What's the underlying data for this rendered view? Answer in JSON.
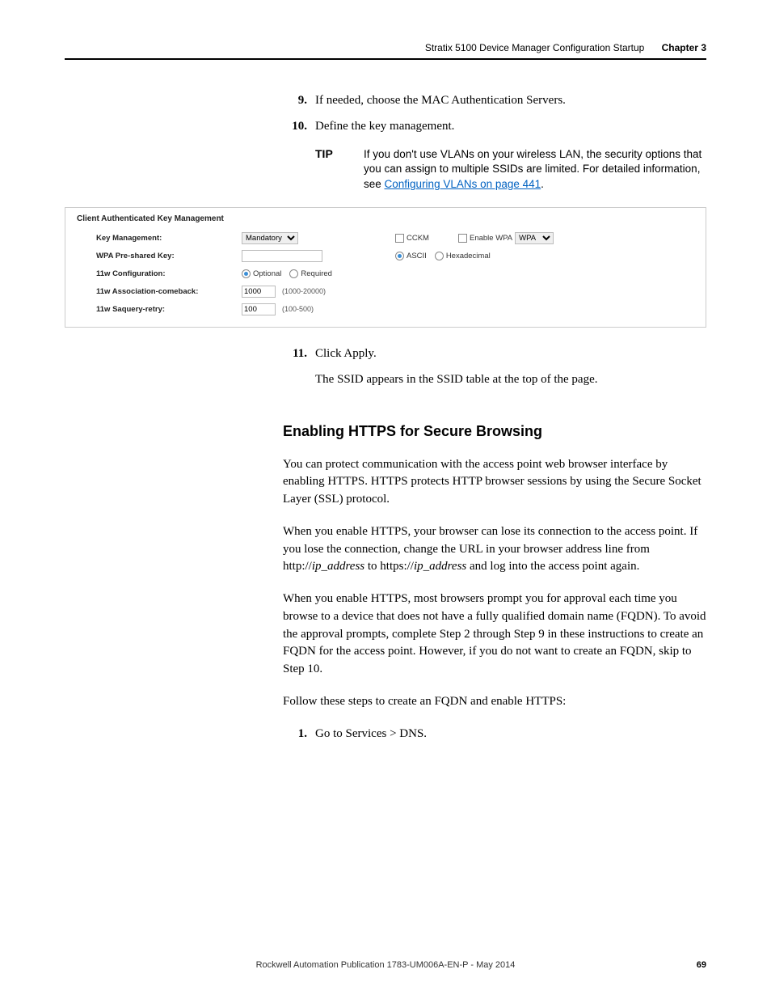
{
  "header": {
    "doc_title": "Stratix 5100 Device Manager Configuration Startup",
    "chapter": "Chapter 3"
  },
  "steps": {
    "s9": {
      "num": "9.",
      "text": "If needed, choose the MAC Authentication Servers."
    },
    "s10": {
      "num": "10.",
      "text": "Define the key management."
    },
    "s11": {
      "num": "11.",
      "text": "Click Apply."
    },
    "s11_after": "The SSID appears in the SSID table at the top of the page.",
    "s1b": {
      "num": "1.",
      "text": "Go to Services > DNS."
    }
  },
  "tip": {
    "label": "TIP",
    "text_pre": "If you don't use VLANs on your wireless LAN, the security options that you can assign to multiple SSIDs are limited. For detailed information, see ",
    "link": "Configuring VLANs on page 441",
    "text_post": "."
  },
  "panel": {
    "heading": "Client Authenticated Key Management",
    "rows": {
      "km": {
        "label": "Key Management:",
        "select": "Mandatory",
        "cckm": "CCKM",
        "enable_wpa": "Enable WPA",
        "wpa_sel": "WPA"
      },
      "psk": {
        "label": "WPA Pre-shared Key:",
        "value": "",
        "ascii": "ASCII",
        "hex": "Hexadecimal"
      },
      "cfg": {
        "label": "11w Configuration:",
        "optional": "Optional",
        "required": "Required"
      },
      "assoc": {
        "label": "11w Association-comeback:",
        "value": "1000",
        "hint": "(1000-20000)"
      },
      "saq": {
        "label": "11w Saquery-retry:",
        "value": "100",
        "hint": "(100-500)"
      }
    }
  },
  "section": {
    "heading": "Enabling HTTPS for Secure Browsing",
    "p1": "You can protect communication with the access point web browser interface by enabling HTTPS. HTTPS protects HTTP browser sessions by using the Secure Socket Layer (SSL) protocol.",
    "p2_a": "When you enable HTTPS, your browser can lose its connection to the access point. If you lose the connection, change the URL in your browser address line from http://",
    "p2_i1": "ip_address",
    "p2_b": " to https://",
    "p2_i2": "ip_address",
    "p2_c": " and log into the access point again.",
    "p3": "When you enable HTTPS, most browsers prompt you for approval each time you browse to a device that does not have a fully qualified domain name (FQDN). To avoid the approval prompts, complete Step 2 through Step 9 in these instructions to create an FQDN for the access point. However, if you do not want to create an FQDN, skip to Step 10.",
    "p4": "Follow these steps to create an FQDN and enable HTTPS:"
  },
  "footer": {
    "pub": "Rockwell Automation Publication 1783-UM006A-EN-P - May 2014",
    "page": "69"
  }
}
